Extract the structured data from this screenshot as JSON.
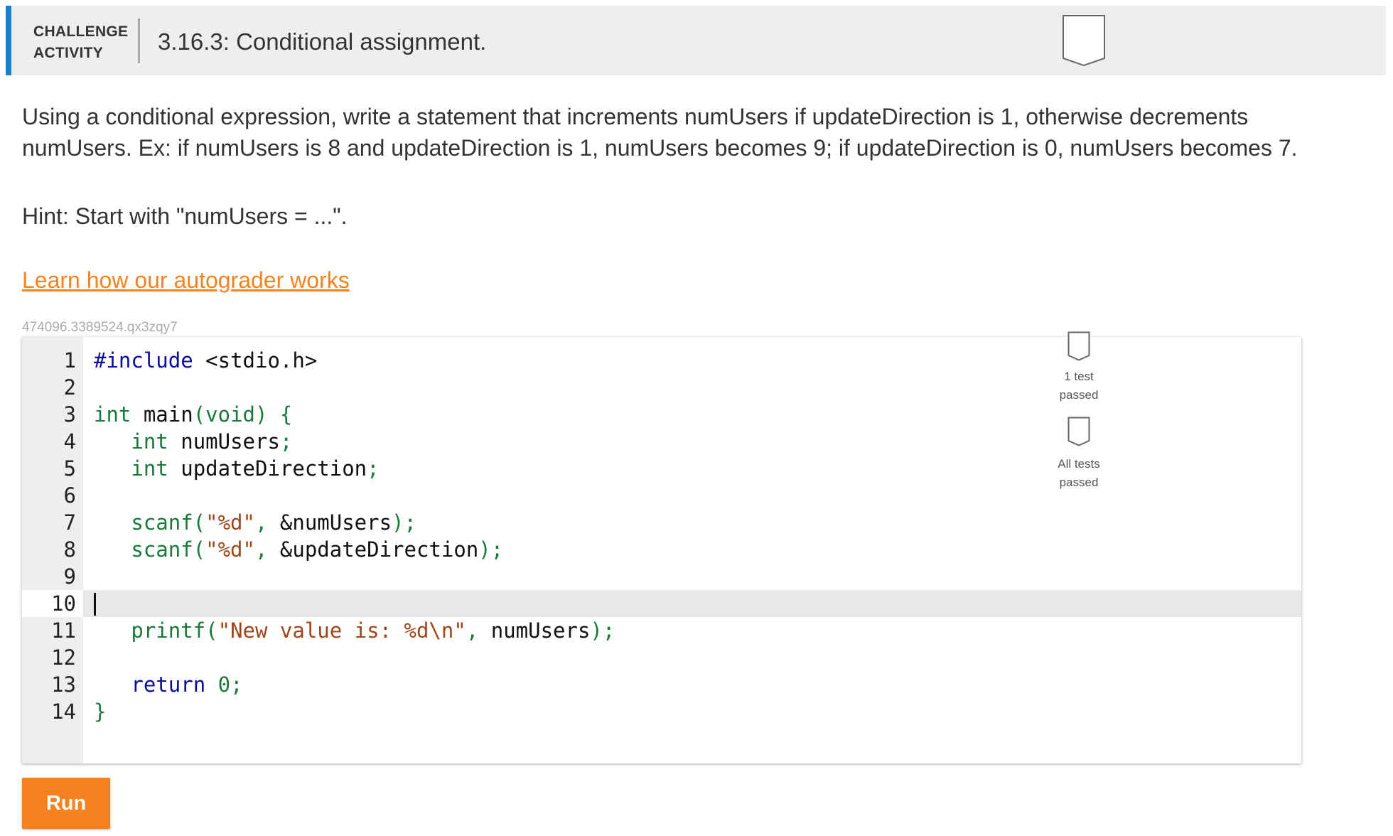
{
  "header": {
    "label": "CHALLENGE\nACTIVITY",
    "title": "3.16.3: Conditional assignment."
  },
  "instructions": {
    "prompt": "Using a conditional expression, write a statement that increments numUsers if updateDirection is 1, otherwise decrements numUsers. Ex: if numUsers is 8 and updateDirection is 1, numUsers becomes 9; if updateDirection is 0, numUsers becomes 7.",
    "hint": "Hint: Start with \"numUsers = ...\".",
    "learn_link": "Learn how our autograder works"
  },
  "editor": {
    "code_id": "474096.3389524.qx3zqy7",
    "active_line": 10,
    "lines": [
      {
        "n": "1",
        "segs": [
          {
            "t": "#include",
            "c": "kw-blue"
          },
          {
            "t": " <stdio.h>",
            "c": ""
          }
        ]
      },
      {
        "n": "2",
        "segs": []
      },
      {
        "n": "3",
        "segs": [
          {
            "t": "int",
            "c": "kw-green"
          },
          {
            "t": " main",
            "c": ""
          },
          {
            "t": "(void) {",
            "c": "kw-green"
          }
        ]
      },
      {
        "n": "4",
        "segs": [
          {
            "t": "   ",
            "c": ""
          },
          {
            "t": "int",
            "c": "kw-green"
          },
          {
            "t": " numUsers",
            "c": ""
          },
          {
            "t": ";",
            "c": "kw-green"
          }
        ]
      },
      {
        "n": "5",
        "segs": [
          {
            "t": "   ",
            "c": ""
          },
          {
            "t": "int",
            "c": "kw-green"
          },
          {
            "t": " updateDirection",
            "c": ""
          },
          {
            "t": ";",
            "c": "kw-green"
          }
        ]
      },
      {
        "n": "6",
        "segs": []
      },
      {
        "n": "7",
        "segs": [
          {
            "t": "   scanf(",
            "c": "kw-green"
          },
          {
            "t": "\"%d\"",
            "c": "str"
          },
          {
            "t": ", ",
            "c": "kw-green"
          },
          {
            "t": "&numUsers",
            "c": ""
          },
          {
            "t": ");",
            "c": "kw-green"
          }
        ]
      },
      {
        "n": "8",
        "segs": [
          {
            "t": "   scanf(",
            "c": "kw-green"
          },
          {
            "t": "\"%d\"",
            "c": "str"
          },
          {
            "t": ", ",
            "c": "kw-green"
          },
          {
            "t": "&updateDirection",
            "c": ""
          },
          {
            "t": ");",
            "c": "kw-green"
          }
        ]
      },
      {
        "n": "9",
        "segs": []
      },
      {
        "n": "10",
        "segs": []
      },
      {
        "n": "11",
        "segs": [
          {
            "t": "   printf(",
            "c": "kw-green"
          },
          {
            "t": "\"New value is: %d\\n\"",
            "c": "str"
          },
          {
            "t": ", ",
            "c": "kw-green"
          },
          {
            "t": "numUsers",
            "c": ""
          },
          {
            "t": ");",
            "c": "kw-green"
          }
        ]
      },
      {
        "n": "12",
        "segs": []
      },
      {
        "n": "13",
        "segs": [
          {
            "t": "   ",
            "c": ""
          },
          {
            "t": "return",
            "c": "kw-blue"
          },
          {
            "t": " ",
            "c": ""
          },
          {
            "t": "0",
            "c": "num"
          },
          {
            "t": ";",
            "c": "kw-green"
          }
        ]
      },
      {
        "n": "14",
        "segs": [
          {
            "t": "}",
            "c": "kw-green"
          }
        ]
      }
    ]
  },
  "progress": {
    "test1_label": "1 test\npassed",
    "all_label": "All tests\npassed"
  },
  "run_label": "Run",
  "colors": {
    "accent": "#1e7fc7",
    "run_button": "#f5821f",
    "link": "#f5821f"
  }
}
